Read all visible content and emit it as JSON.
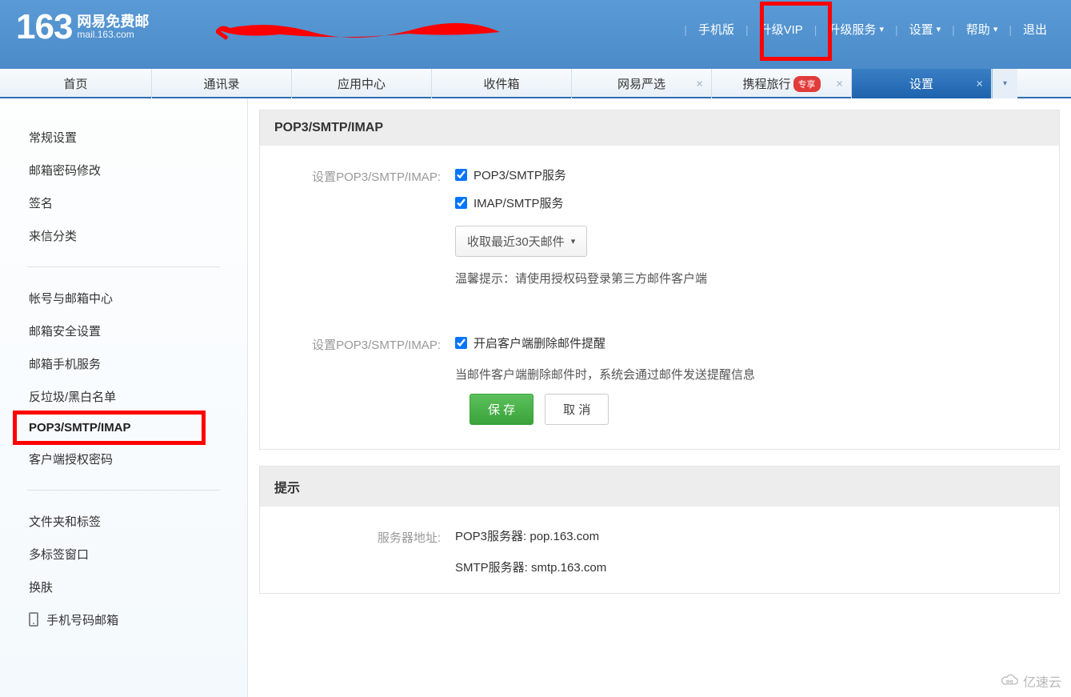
{
  "logo": {
    "number": "163",
    "title": "网易免费邮",
    "sub": "mail.163.com"
  },
  "topnav": {
    "mobile": "手机版",
    "vip": "升级VIP",
    "service": "升级服务",
    "settings": "设置",
    "help": "帮助",
    "logout": "退出"
  },
  "tabs": {
    "home": "首页",
    "contacts": "通讯录",
    "apps": "应用中心",
    "inbox": "收件箱",
    "yanxuan": "网易严选",
    "ctrip": "携程旅行",
    "ctrip_badge": "专享",
    "settings": "设置"
  },
  "sidebar": {
    "general": "常规设置",
    "password": "邮箱密码修改",
    "signature": "签名",
    "classify": "来信分类",
    "account": "帐号与邮箱中心",
    "security": "邮箱安全设置",
    "phone_service": "邮箱手机服务",
    "spam": "反垃圾/黑白名单",
    "pop3": "POP3/SMTP/IMAP",
    "auth_code": "客户端授权密码",
    "folders": "文件夹和标签",
    "multiwindow": "多标签窗口",
    "skin": "换肤",
    "mobile_mailbox": "手机号码邮箱"
  },
  "panel1": {
    "title": "POP3/SMTP/IMAP",
    "label1": "设置POP3/SMTP/IMAP:",
    "opt_pop3": "POP3/SMTP服务",
    "opt_imap": "IMAP/SMTP服务",
    "select_text": "收取最近30天邮件",
    "tip": "温馨提示：请使用授权码登录第三方邮件客户端",
    "label2": "设置POP3/SMTP/IMAP:",
    "opt_delete_notify": "开启客户端删除邮件提醒",
    "delete_desc": "当邮件客户端删除邮件时，系统会通过邮件发送提醒信息",
    "save": "保 存",
    "cancel": "取 消"
  },
  "panel2": {
    "title": "提示",
    "label": "服务器地址:",
    "pop3_server": "POP3服务器: pop.163.com",
    "smtp_server": "SMTP服务器: smtp.163.com"
  },
  "watermark": "亿速云"
}
